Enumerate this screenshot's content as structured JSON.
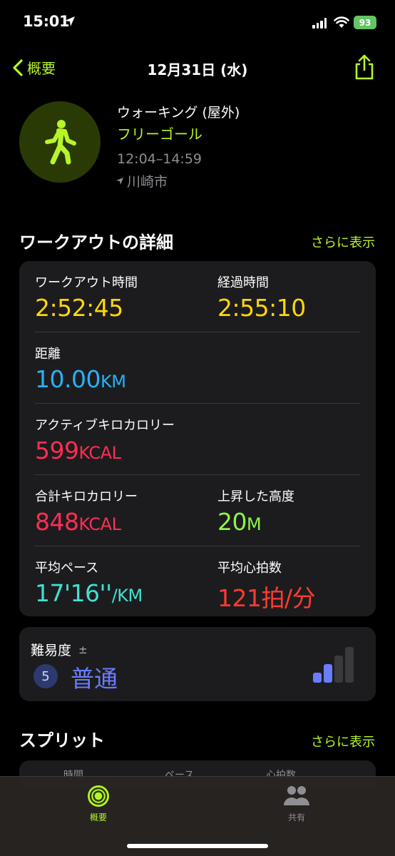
{
  "status": {
    "time": "15:01",
    "battery": "93"
  },
  "nav": {
    "back_label": "概要",
    "title": "12月31日 (水)"
  },
  "workout": {
    "type": "ウォーキング (屋外)",
    "goal": "フリーゴール",
    "time_range": "12:04–14:59",
    "location": "川崎市"
  },
  "details": {
    "title": "ワークアウトの詳細",
    "more": "さらに表示",
    "workout_time": {
      "label": "ワークアウト時間",
      "value": "2:52:45"
    },
    "elapsed_time": {
      "label": "経過時間",
      "value": "2:55:10"
    },
    "distance": {
      "label": "距離",
      "value": "10.00",
      "unit": "KM"
    },
    "active_kcal": {
      "label": "アクティブキロカロリー",
      "value": "599",
      "unit": "KCAL"
    },
    "total_kcal": {
      "label": "合計キロカロリー",
      "value": "848",
      "unit": "KCAL"
    },
    "elevation": {
      "label": "上昇した高度",
      "value": "20",
      "unit": "M"
    },
    "avg_pace": {
      "label": "平均ペース",
      "value": "17'16''",
      "unit": "/KM"
    },
    "avg_hr": {
      "label": "平均心拍数",
      "value": "121拍/分"
    }
  },
  "effort": {
    "label": "難易度",
    "pm": "±",
    "level": "5",
    "value": "普通",
    "bars_filled": 2,
    "bars_total": 4
  },
  "splits": {
    "title": "スプリット",
    "more": "さらに表示",
    "columns": [
      "時間",
      "ペース",
      "心拍数"
    ]
  },
  "tabs": [
    {
      "label": "概要",
      "active": true
    },
    {
      "label": "共有",
      "active": false
    }
  ],
  "colors": {
    "accent": "#b6f52a",
    "effort": "#6a7cff"
  }
}
